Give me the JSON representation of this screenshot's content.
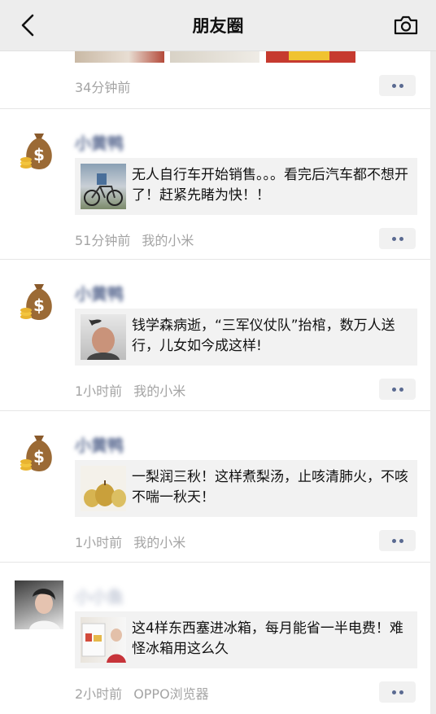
{
  "navbar": {
    "title": "朋友圈",
    "back_icon": "chevron-left-icon",
    "camera_icon": "camera-icon"
  },
  "posts": [
    {
      "time": "34分钟前",
      "source": ""
    },
    {
      "name": "小黄鸭",
      "avatar": "money-bag-avatar",
      "link_title": "无人自行车开始销售。。。看完后汽车都不想开了！赶紧先睹为快！！",
      "time": "51分钟前",
      "source": "我的小米"
    },
    {
      "name": "小黄鸭",
      "avatar": "money-bag-avatar",
      "link_title": "钱学森病逝，“三军仪仗队”抬棺，数万人送行，儿女如今成这样!",
      "time": "1小时前",
      "source": "我的小米"
    },
    {
      "name": "小黄鸭",
      "avatar": "money-bag-avatar",
      "link_title": "一梨润三秋！这样煮梨汤，止咳清肺火，不咳不喘一秋天！",
      "time": "1小时前",
      "source": "我的小米"
    },
    {
      "name": "小小鱼",
      "avatar": "user-photo-avatar",
      "link_title": "这4样东西塞进冰箱，每月能省一半电费！难怪冰箱用这么久",
      "time": "2小时前",
      "source": "OPPO浏览器"
    }
  ],
  "colors": {
    "background": "#ededed",
    "card": "#ffffff",
    "name_blue": "#5a6a91",
    "meta_gray": "#a4a4a4",
    "link_bg": "#f2f2f2"
  }
}
